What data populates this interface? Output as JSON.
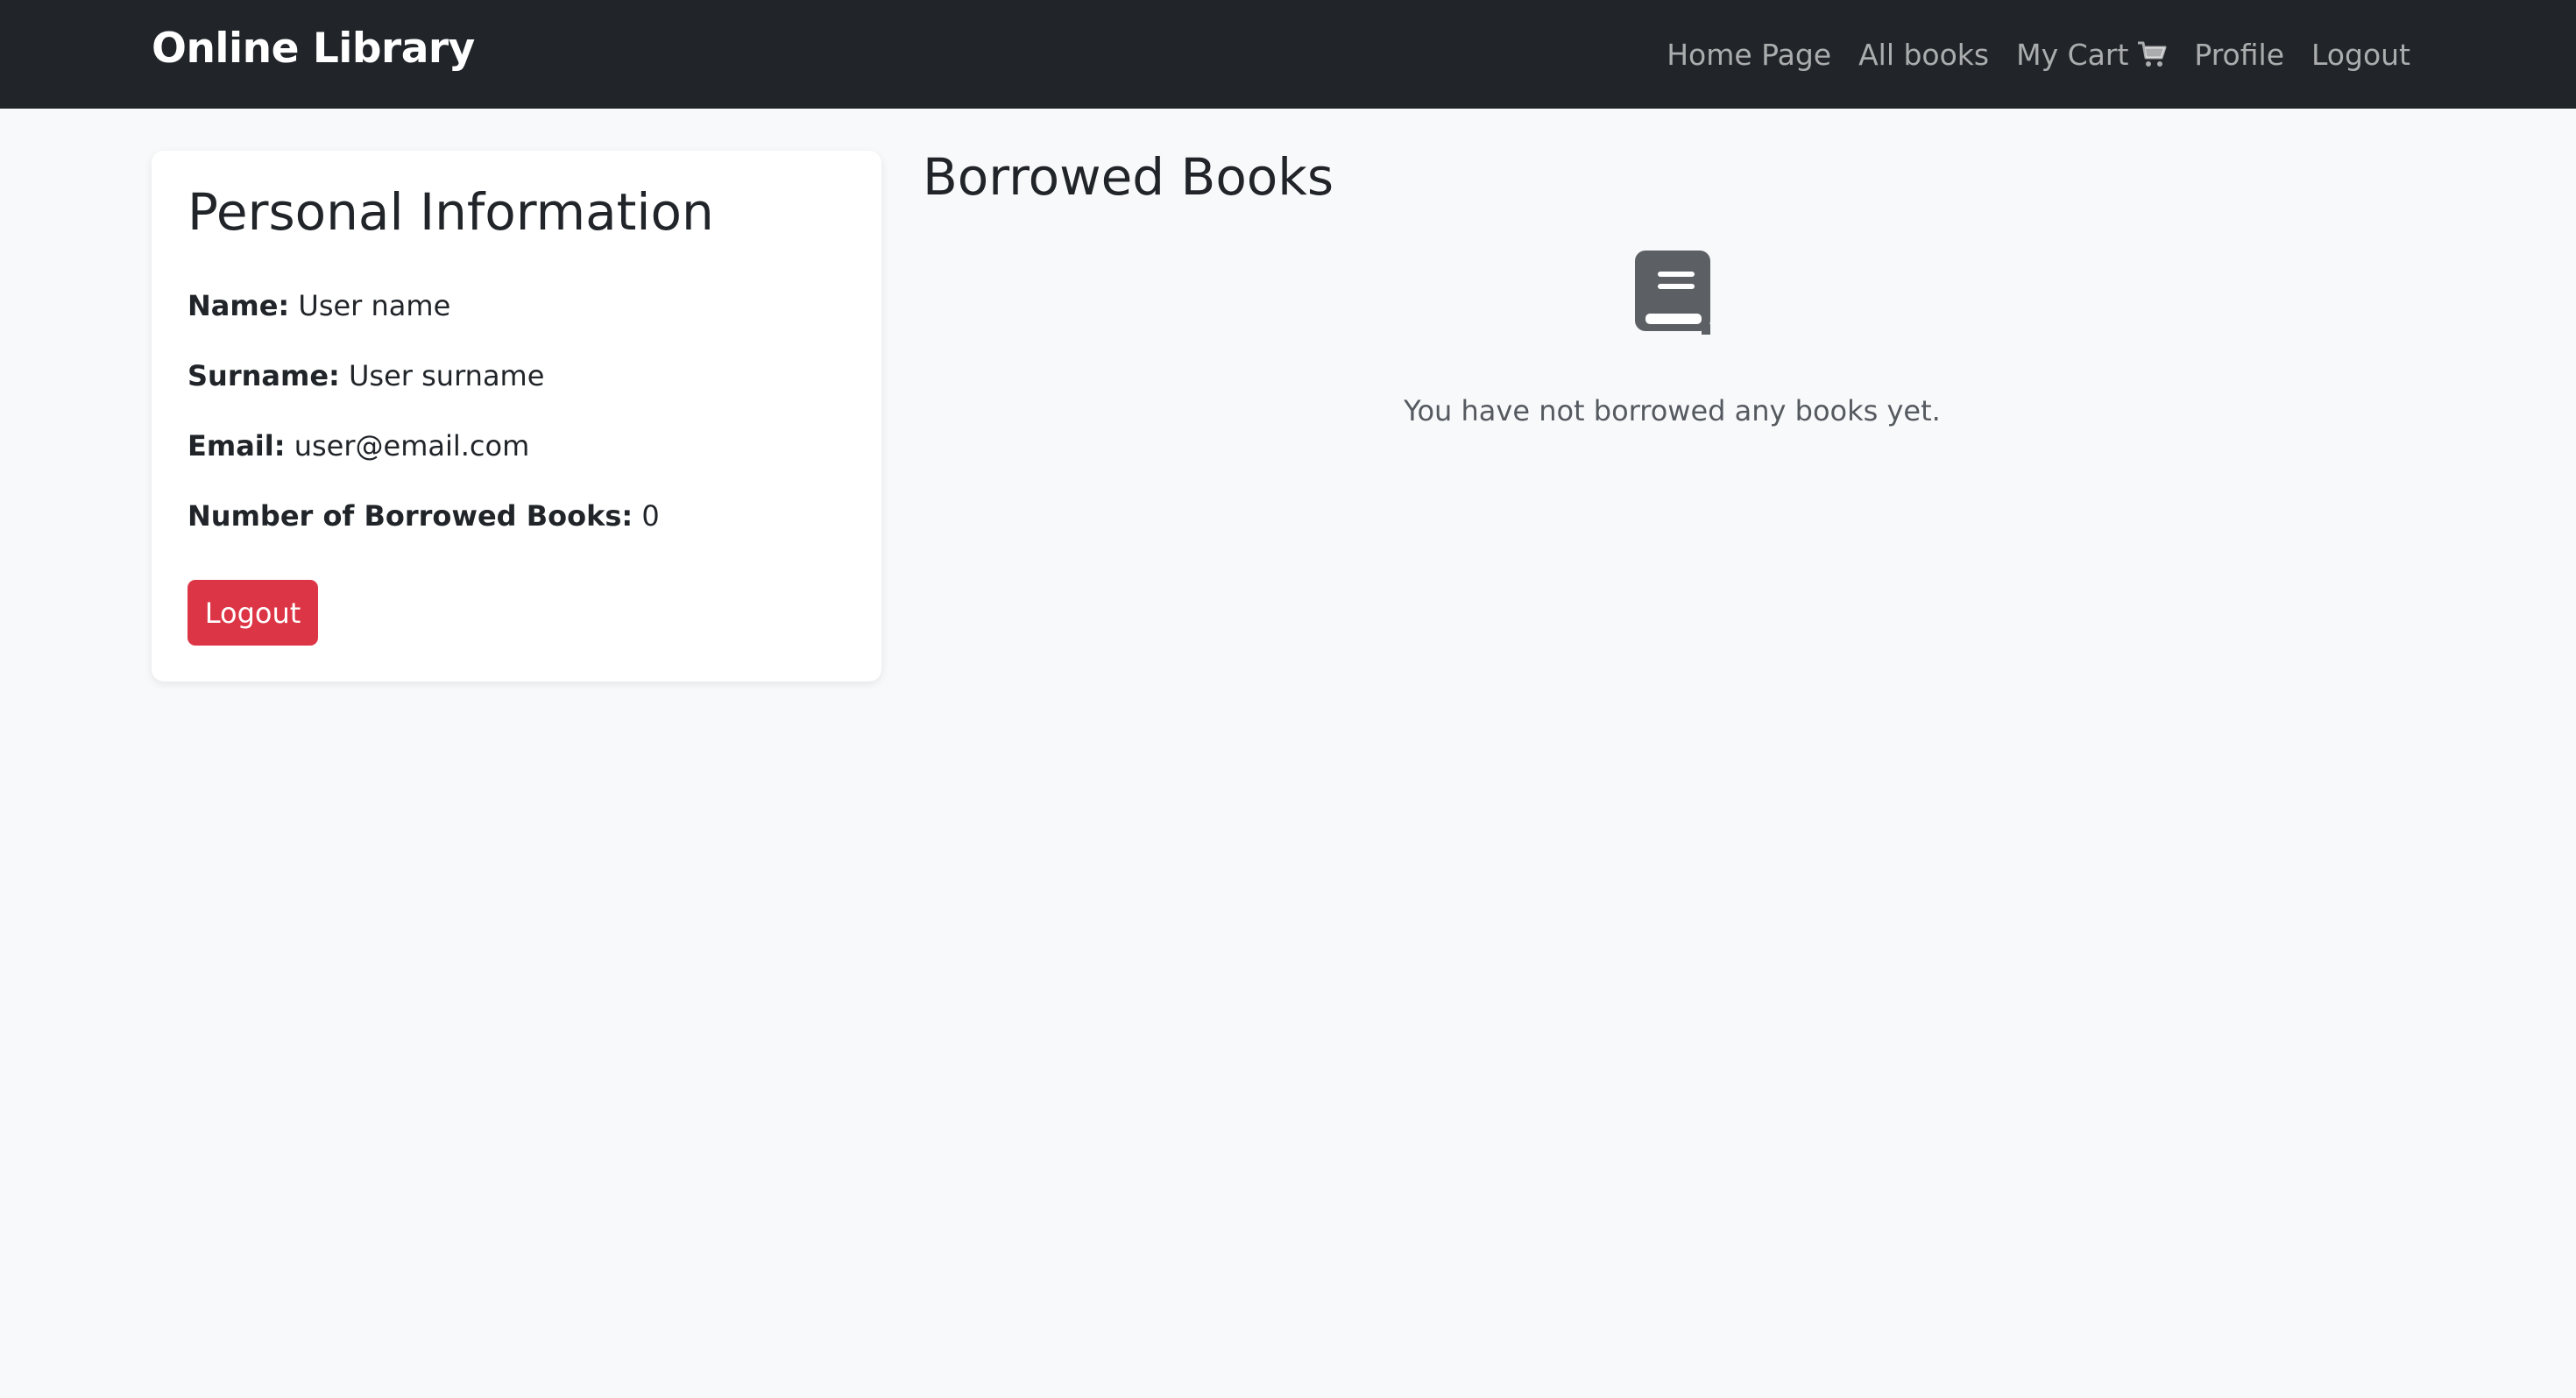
{
  "navbar": {
    "brand": "Online Library",
    "links": {
      "home": "Home Page",
      "all_books": "All books",
      "cart": "My Cart",
      "cart_icon": "shopping-cart-icon",
      "profile": "Profile",
      "logout": "Logout"
    }
  },
  "profile": {
    "title": "Personal Information",
    "name_label": "Name:",
    "name_value": "User name",
    "surname_label": "Surname:",
    "surname_value": "User surname",
    "email_label": "Email:",
    "email_value": "user@email.com",
    "count_label": "Number of Borrowed Books:",
    "count_value": "0",
    "logout_button": "Logout"
  },
  "borrowed": {
    "title": "Borrowed Books",
    "empty_icon": "book-icon",
    "empty_message": "You have not borrowed any books yet."
  },
  "colors": {
    "navbar_bg": "#212529",
    "page_bg": "#f8f9fa",
    "danger": "#dc3545"
  }
}
